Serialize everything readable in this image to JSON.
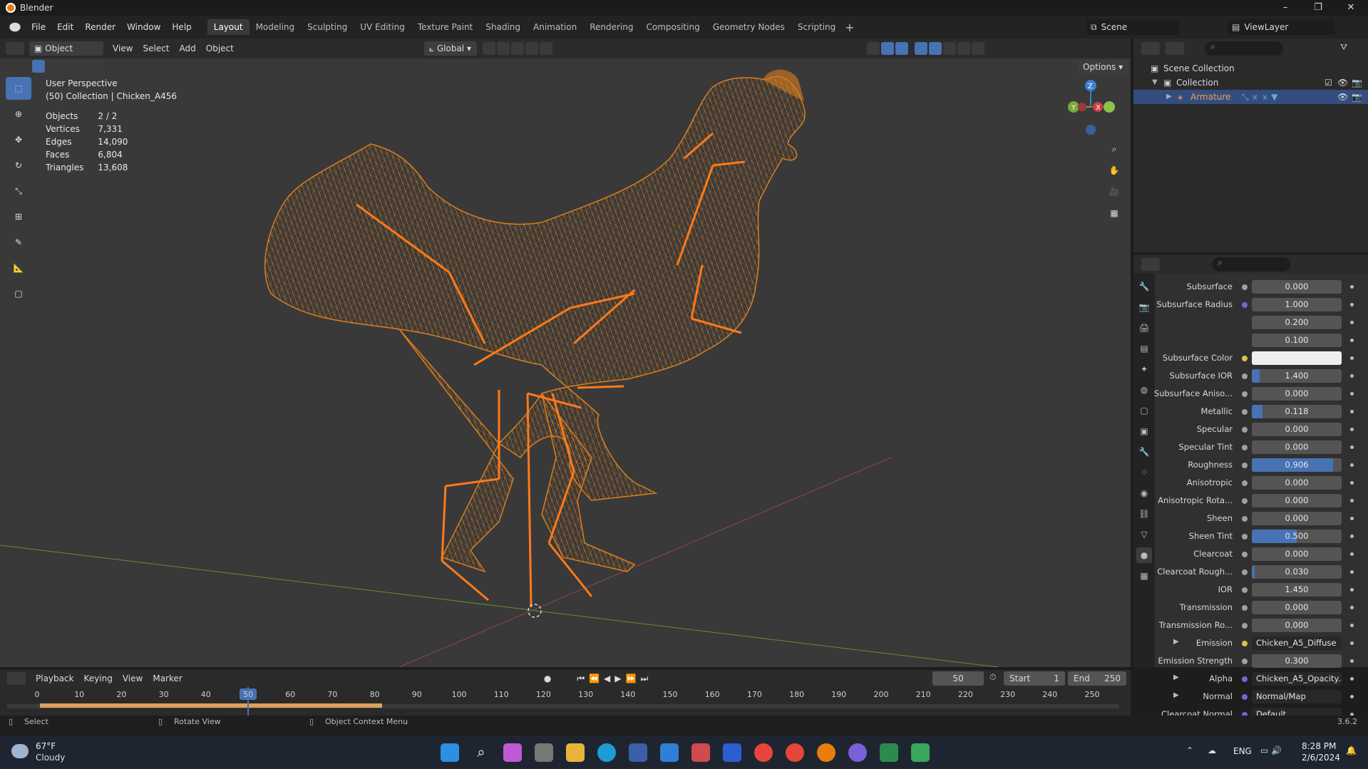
{
  "app": {
    "title": "Blender",
    "version": "3.6.2"
  },
  "menu": [
    "File",
    "Edit",
    "Render",
    "Window",
    "Help"
  ],
  "workspaces": [
    "Layout",
    "Modeling",
    "Sculpting",
    "UV Editing",
    "Texture Paint",
    "Shading",
    "Animation",
    "Rendering",
    "Compositing",
    "Geometry Nodes",
    "Scripting"
  ],
  "active_workspace": "Layout",
  "scene": {
    "name": "Scene",
    "view_layer": "ViewLayer"
  },
  "viewport_header": {
    "mode": "Object Mode",
    "menus": [
      "View",
      "Select",
      "Add",
      "Object"
    ],
    "orientation": "Global",
    "options": "Options"
  },
  "viewport": {
    "perspective": "User Perspective",
    "collection_line": "(50) Collection | Chicken_A456",
    "stats": [
      {
        "label": "Objects",
        "value": "2 / 2"
      },
      {
        "label": "Vertices",
        "value": "7,331"
      },
      {
        "label": "Edges",
        "value": "14,090"
      },
      {
        "label": "Faces",
        "value": "6,804"
      },
      {
        "label": "Triangles",
        "value": "13,608"
      }
    ],
    "gizmo_axes": [
      "Z",
      "Y",
      "X"
    ],
    "wire_color": "#e3821e",
    "bone_color": "#ff7a1a"
  },
  "outliner": {
    "scene_collection": "Scene Collection",
    "collection": "Collection",
    "armature": "Armature"
  },
  "properties": {
    "rows": [
      {
        "label": "Subsurface",
        "value": "0.000",
        "dot": "gray"
      },
      {
        "label": "Subsurface Radius",
        "value": "1.000",
        "dot": "blue"
      },
      {
        "label": "",
        "value": "0.200",
        "dot": "none"
      },
      {
        "label": "",
        "value": "0.100",
        "dot": "none"
      },
      {
        "label": "Subsurface Color",
        "value": "",
        "dot": "yellow",
        "type": "color",
        "color": "#eeeeee"
      },
      {
        "label": "Subsurface IOR",
        "value": "1.400",
        "dot": "gray",
        "fill": 0.09
      },
      {
        "label": "Subsurface Aniso...",
        "value": "0.000",
        "dot": "gray"
      },
      {
        "label": "Metallic",
        "value": "0.118",
        "dot": "gray",
        "fill": 0.118
      },
      {
        "label": "Specular",
        "value": "0.000",
        "dot": "gray"
      },
      {
        "label": "Specular Tint",
        "value": "0.000",
        "dot": "gray"
      },
      {
        "label": "Roughness",
        "value": "0.906",
        "dot": "gray",
        "fill": 0.906
      },
      {
        "label": "Anisotropic",
        "value": "0.000",
        "dot": "gray"
      },
      {
        "label": "Anisotropic Rota...",
        "value": "0.000",
        "dot": "gray"
      },
      {
        "label": "Sheen",
        "value": "0.000",
        "dot": "gray"
      },
      {
        "label": "Sheen Tint",
        "value": "0.500",
        "dot": "gray",
        "fill": 0.5
      },
      {
        "label": "Clearcoat",
        "value": "0.000",
        "dot": "gray"
      },
      {
        "label": "Clearcoat Rough...",
        "value": "0.030",
        "dot": "gray",
        "fill": 0.03
      },
      {
        "label": "IOR",
        "value": "1.450",
        "dot": "gray"
      },
      {
        "label": "Transmission",
        "value": "0.000",
        "dot": "gray"
      },
      {
        "label": "Transmission Ro...",
        "value": "0.000",
        "dot": "gray"
      },
      {
        "label": "Emission",
        "value": "Chicken_A5_Diffuse",
        "dot": "yellow",
        "type": "text",
        "arrow": true
      },
      {
        "label": "Emission Strength",
        "value": "0.300",
        "dot": "gray"
      },
      {
        "label": "Alpha",
        "value": "Chicken_A5_Opacity...",
        "dot": "blue",
        "type": "text",
        "arrow": true
      },
      {
        "label": "Normal",
        "value": "Normal/Map",
        "dot": "blue",
        "type": "text",
        "arrow": true
      },
      {
        "label": "Clearcoat Normal",
        "value": "Default",
        "dot": "blue",
        "type": "text"
      }
    ]
  },
  "timeline": {
    "menus": [
      "Playback",
      "Keying",
      "View",
      "Marker"
    ],
    "current_frame": "50",
    "start_label": "Start",
    "start": "1",
    "end_label": "End",
    "end": "250",
    "ticks": [
      "0",
      "10",
      "20",
      "30",
      "40",
      "50",
      "60",
      "70",
      "80",
      "90",
      "100",
      "110",
      "120",
      "130",
      "140",
      "150",
      "160",
      "170",
      "180",
      "190",
      "200",
      "210",
      "220",
      "230",
      "240",
      "250"
    ]
  },
  "statusbar": {
    "select": "Select",
    "rotate": "Rotate View",
    "context": "Object Context Menu",
    "version": "3.6.2"
  },
  "taskbar": {
    "weather_temp": "67°F",
    "weather_desc": "Cloudy",
    "lang": "ENG",
    "time": "8:28 PM",
    "date": "2/6/2024"
  }
}
